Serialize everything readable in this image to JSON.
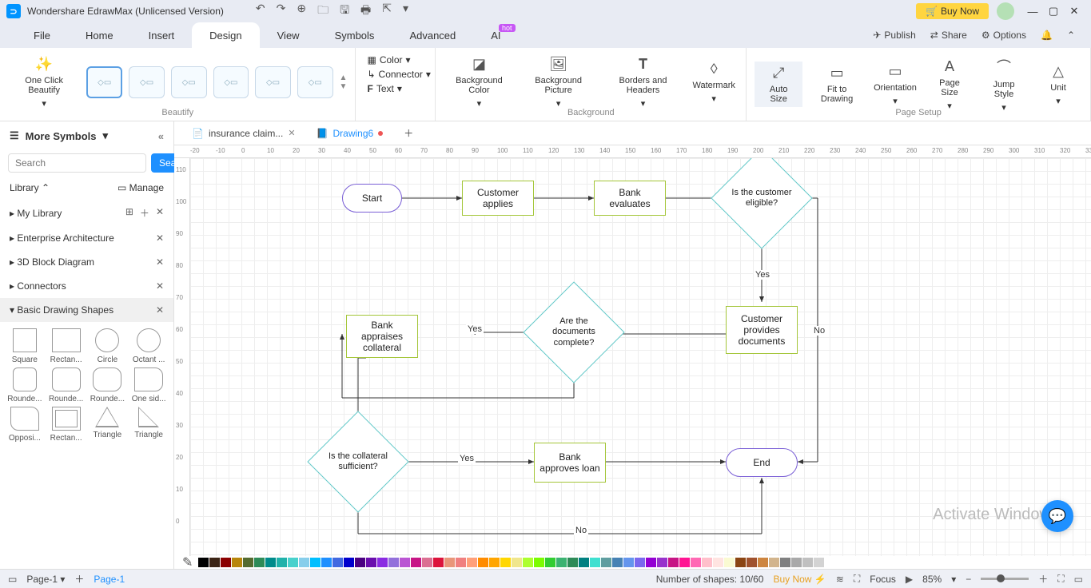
{
  "titlebar": {
    "app_title": "Wondershare EdrawMax (Unlicensed Version)",
    "buy_now": "Buy Now"
  },
  "menubar": {
    "items": [
      "File",
      "Home",
      "Insert",
      "Design",
      "View",
      "Symbols",
      "Advanced",
      "AI"
    ],
    "active_index": 3,
    "right": {
      "publish": "Publish",
      "share": "Share",
      "options": "Options"
    }
  },
  "ribbon": {
    "one_click": "One Click Beautify",
    "groups": {
      "beautify": "Beautify",
      "background": "Background",
      "page_setup": "Page Setup"
    },
    "color": "Color",
    "connector": "Connector",
    "text": "Text",
    "bg_color": "Background Color",
    "bg_picture": "Background Picture",
    "borders": "Borders and Headers",
    "watermark": "Watermark",
    "auto_size": "Auto Size",
    "fit": "Fit to Drawing",
    "orientation": "Orientation",
    "page_size": "Page Size",
    "jump_style": "Jump Style",
    "unit": "Unit"
  },
  "sidebar": {
    "more_symbols": "More Symbols",
    "search_placeholder": "Search",
    "search_btn": "Search",
    "library": "Library",
    "manage": "Manage",
    "cats": [
      "My Library",
      "Enterprise Architecture",
      "3D Block Diagram",
      "Connectors",
      "Basic Drawing Shapes"
    ],
    "shapes": [
      "Square",
      "Rectan...",
      "Circle",
      "Octant ...",
      "Rounde...",
      "Rounde...",
      "Rounde...",
      "One sid...",
      "Opposi...",
      "Rectan...",
      "Triangle",
      "Triangle"
    ]
  },
  "tabs": {
    "items": [
      {
        "label": "insurance claim...",
        "active": false,
        "modified": false
      },
      {
        "label": "Drawing6",
        "active": true,
        "modified": true
      }
    ]
  },
  "ruler_h_start": -20,
  "ruler_h_step": 10,
  "ruler_h_count": 36,
  "ruler_v": [
    "110",
    "100",
    "90",
    "80",
    "70",
    "60",
    "50",
    "40",
    "30",
    "20",
    "10",
    "0"
  ],
  "flowchart": {
    "start": "Start",
    "customer_applies": "Customer applies",
    "bank_evaluates": "Bank evaluates",
    "is_eligible": "Is the customer eligible?",
    "provides_docs": "Customer provides documents",
    "docs_complete": "Are the documents complete?",
    "appraises": "Bank appraises collateral",
    "collateral_sufficient": "Is the collateral sufficient?",
    "approves": "Bank approves loan",
    "end": "End",
    "yes": "Yes",
    "no": "No"
  },
  "colorbar_colors": [
    "#000000",
    "#3c2415",
    "#8b0000",
    "#b8860b",
    "#556b2f",
    "#2e8b57",
    "#008b8b",
    "#20b2aa",
    "#48d1cc",
    "#87ceeb",
    "#00bfff",
    "#1e90ff",
    "#4169e1",
    "#0000cd",
    "#4b0082",
    "#6a0dad",
    "#8a2be2",
    "#9370db",
    "#ba55d3",
    "#c71585",
    "#db7093",
    "#dc143c",
    "#e9967a",
    "#f08080",
    "#ffa07a",
    "#ff8c00",
    "#ffa500",
    "#ffd700",
    "#f0e68c",
    "#adff2f",
    "#7cfc00",
    "#32cd32",
    "#3cb371",
    "#2e8b57",
    "#008080",
    "#40e0d0",
    "#5f9ea0",
    "#4682b4",
    "#6495ed",
    "#7b68ee",
    "#9400d3",
    "#9932cc",
    "#c71585",
    "#ff1493",
    "#ff69b4",
    "#ffc0cb",
    "#ffe4e1",
    "#fafad2",
    "#8b4513",
    "#a0522d",
    "#cd853f",
    "#d2b48c",
    "#808080",
    "#a9a9a9",
    "#c0c0c0",
    "#d3d3d3"
  ],
  "statusbar": {
    "page_label": "Page-1",
    "page_tab": "Page-1",
    "shapes": "Number of shapes: 10/60",
    "buy_now": "Buy Now",
    "focus": "Focus",
    "zoom": "85%"
  },
  "watermark": "Activate Windows"
}
